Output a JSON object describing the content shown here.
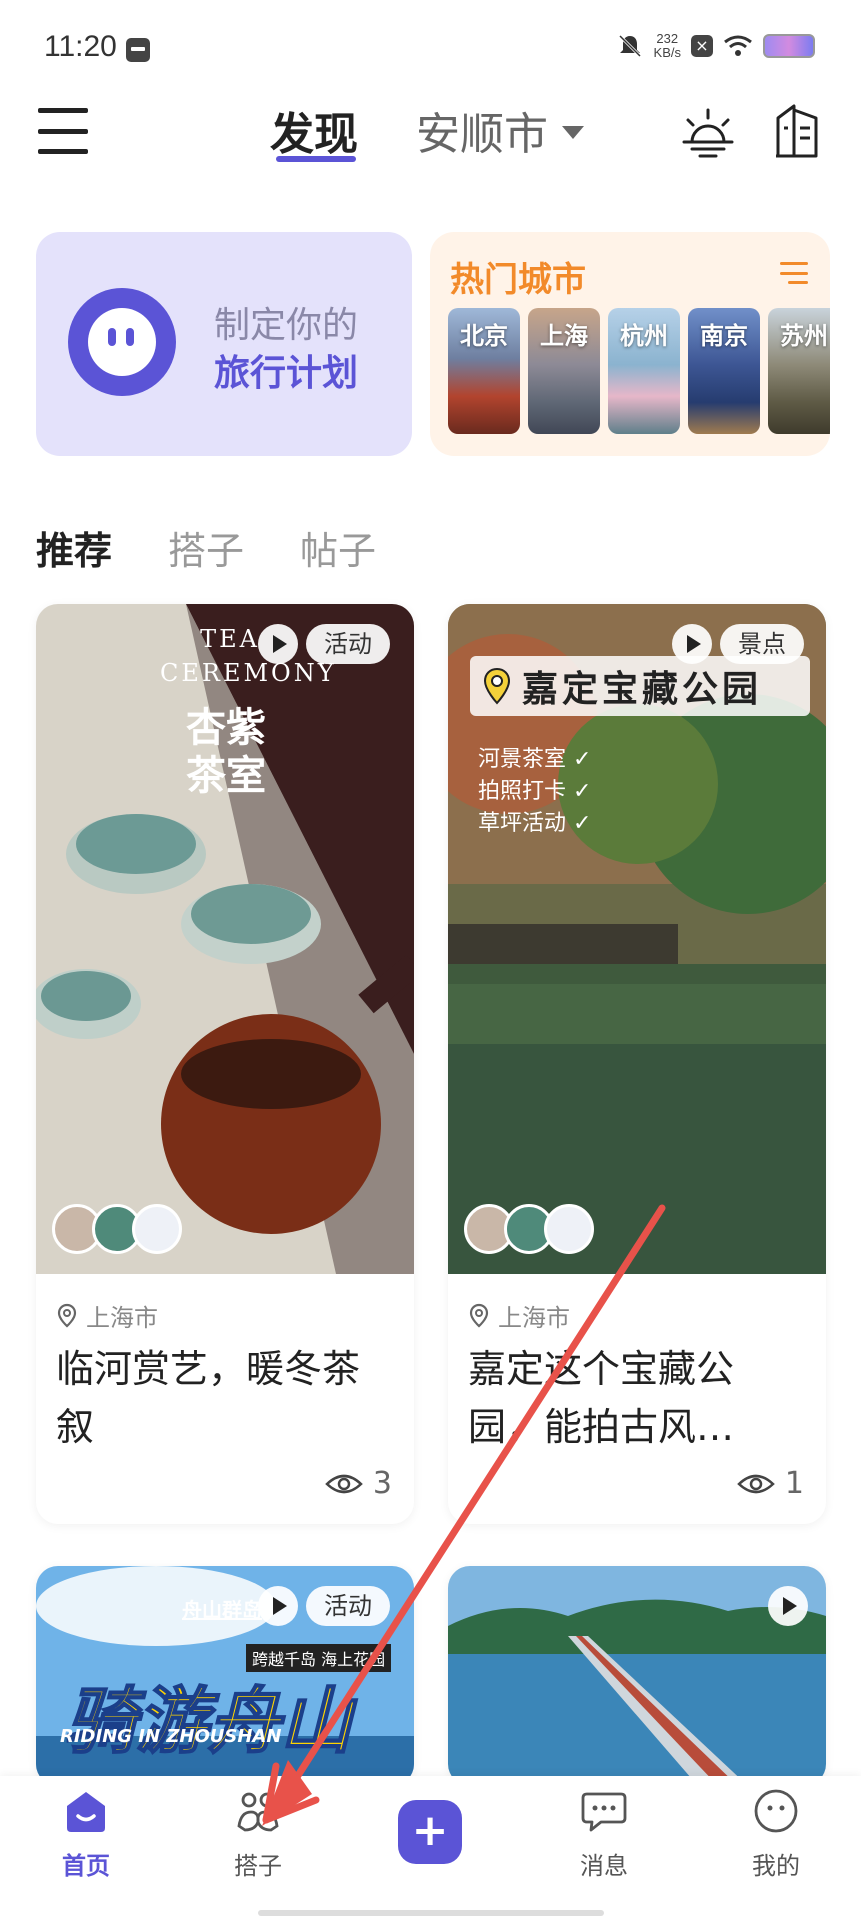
{
  "status_bar": {
    "time": "11:20",
    "net_speed": "232\nKB/s",
    "net_speed_value": "232",
    "net_speed_unit": "KB/s",
    "icons": [
      "sim-icon",
      "mute-bell-icon",
      "close-notif-icon",
      "wifi-icon",
      "battery-icon"
    ]
  },
  "header": {
    "active_tab": "发现",
    "city": "安顺市",
    "icons": [
      "menu-icon",
      "weather-icon",
      "building-icon"
    ]
  },
  "plan_card": {
    "line1": "制定你的",
    "line2": "旅行计划"
  },
  "hot_cities": {
    "title": "热门城市",
    "cities": [
      "北京",
      "上海",
      "杭州",
      "南京",
      "苏州"
    ]
  },
  "section_tabs": [
    "推荐",
    "搭子",
    "帖子"
  ],
  "feed": [
    {
      "tag": "活动",
      "overlay_text_en": "TEA\nCEREMONY",
      "overlay_text_cn": "杏紫\n茶室",
      "location": "上海市",
      "title": "临河赏艺，暖冬茶叙",
      "views": "3"
    },
    {
      "tag": "景点",
      "overlay_title": "嘉定宝藏公园",
      "overlay_checks": [
        "河景茶室",
        "拍照打卡",
        "草坪活动"
      ],
      "location": "上海市",
      "title": "嘉定这个宝藏公园，能拍古风…",
      "views": "1"
    },
    {
      "tag": "活动",
      "overlay_brand": "舟山群岛",
      "overlay_sub": "跨越千岛 海上花园",
      "overlay_main": "骑游舟山",
      "overlay_en": "RIDING IN ZHOUSHAN",
      "overlay_bottom": "…"
    },
    {
      "tag": "",
      "overlay_logo": "…"
    }
  ],
  "bottom_nav": {
    "items": [
      {
        "label": "首页",
        "icon": "home-icon",
        "active": true
      },
      {
        "label": "搭子",
        "icon": "buddies-icon",
        "active": false
      },
      {
        "label": "+",
        "icon": "add-icon",
        "active": false
      },
      {
        "label": "消息",
        "icon": "message-icon",
        "active": false
      },
      {
        "label": "我的",
        "icon": "profile-icon",
        "active": false
      }
    ]
  },
  "colors": {
    "accent": "#5b54d6",
    "hot_orange": "#f28a2a",
    "annotation_red": "#e8524a"
  }
}
